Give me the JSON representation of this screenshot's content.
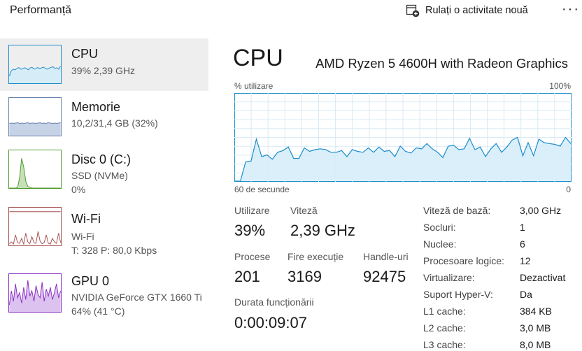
{
  "header": {
    "title": "Performanță",
    "run_task_label": "Rulați o activitate nouă",
    "more_label": "···"
  },
  "sidebar": {
    "items": [
      {
        "name": "CPU",
        "sub1": "39%  2,39 GHz",
        "sub2": ""
      },
      {
        "name": "Memorie",
        "sub1": "10,2/31,4 GB (32%)",
        "sub2": ""
      },
      {
        "name": "Disc 0 (C:)",
        "sub1": "SSD (NVMe)",
        "sub2": "0%"
      },
      {
        "name": "Wi-Fi",
        "sub1": "Wi-Fi",
        "sub2": "T: 328  P: 80,0 Kbps"
      },
      {
        "name": "GPU 0",
        "sub1": "NVIDIA GeForce GTX 1660 Ti",
        "sub2": "64%  (41 °C)"
      }
    ]
  },
  "main": {
    "title": "CPU",
    "model": "AMD Ryzen 5 4600H with Radeon Graphics",
    "graph_label_left": "% utilizare",
    "graph_label_right": "100%",
    "graph_bottom_left": "60 de secunde",
    "graph_bottom_right": "0"
  },
  "stats": {
    "utilizare_label": "Utilizare",
    "utilizare_value": "39%",
    "viteza_label": "Viteză",
    "viteza_value": "2,39 GHz",
    "procese_label": "Procese",
    "procese_value": "201",
    "fire_label": "Fire execuție",
    "fire_value": "3169",
    "handle_label": "Handle-uri",
    "handle_value": "92475",
    "durata_label": "Durata funcționării",
    "durata_value": "0:00:09:07"
  },
  "specs": [
    {
      "key": "Viteză de bază:",
      "value": "3,00 GHz"
    },
    {
      "key": "Socluri:",
      "value": "1"
    },
    {
      "key": "Nuclee:",
      "value": "6"
    },
    {
      "key": "Procesoare logice:",
      "value": "12"
    },
    {
      "key": "Virtualizare:",
      "value": "Dezactivat"
    },
    {
      "key": "Suport Hyper-V:",
      "value": "Da"
    },
    {
      "key": "L1 cache:",
      "value": "384 KB"
    },
    {
      "key": "L2 cache:",
      "value": "3,0 MB"
    },
    {
      "key": "L3 cache:",
      "value": "8,0 MB"
    }
  ],
  "chart_data": {
    "type": "area",
    "ylim": [
      0,
      100
    ],
    "grid": true,
    "x_label_left": "60 de secunde",
    "x_label_right": "0",
    "y_label": "% utilizare",
    "y_max_label": "100%",
    "values": [
      0,
      0,
      22,
      23,
      48,
      28,
      30,
      25,
      33,
      35,
      39,
      26,
      26,
      38,
      34,
      36,
      37,
      36,
      33,
      33,
      35,
      28,
      36,
      34,
      33,
      38,
      33,
      39,
      34,
      35,
      28,
      40,
      34,
      32,
      38,
      37,
      43,
      37,
      33,
      27,
      40,
      41,
      36,
      37,
      49,
      36,
      39,
      28,
      37,
      43,
      33,
      39,
      47,
      50,
      29,
      44,
      29,
      48,
      44,
      43,
      42,
      40,
      50,
      43
    ]
  },
  "thumbs": {
    "cpu": [
      20,
      35,
      40,
      38,
      42,
      45,
      40,
      41,
      44,
      42,
      38,
      44,
      45,
      40,
      42,
      45,
      41,
      44,
      46,
      42,
      40,
      43,
      45,
      47,
      42,
      44,
      40,
      48
    ],
    "mem": [
      35,
      36,
      35,
      36,
      37,
      35,
      36,
      35,
      36,
      37,
      35,
      36,
      36,
      35,
      36,
      37,
      35,
      36,
      35,
      37,
      36,
      35,
      36,
      35,
      36,
      37
    ],
    "disc": [
      0,
      0,
      0,
      0,
      2,
      30,
      85,
      60,
      20,
      5,
      2,
      0,
      0,
      0,
      0,
      0,
      0,
      0,
      0,
      0,
      0,
      0,
      0,
      0,
      0,
      0
    ],
    "wifi": [
      5,
      10,
      4,
      30,
      8,
      6,
      20,
      4,
      35,
      10,
      5,
      25,
      8,
      6,
      40,
      12,
      5,
      8,
      30,
      6,
      4,
      20,
      10,
      6,
      35,
      8
    ],
    "gpu": [
      20,
      60,
      30,
      80,
      40,
      55,
      25,
      70,
      35,
      90,
      45,
      60,
      30,
      75,
      50,
      40,
      85,
      30,
      65,
      45,
      70,
      35,
      55,
      80,
      40,
      60
    ]
  },
  "colors": {
    "cpu_stroke": "#1c8ccc",
    "cpu_fill": "#d6edf8",
    "grid": "#d9eaf4",
    "mem_stroke": "#6a83ad",
    "mem_fill": "#c6d3e6",
    "disc_stroke": "#4c9a2a",
    "disc_fill": "#c7e0b9",
    "wifi_stroke": "#a74f4f",
    "gpu_stroke": "#8a2ec4",
    "gpu_fill": "#dcc2ee",
    "selected_bg": "#eeeeee"
  }
}
